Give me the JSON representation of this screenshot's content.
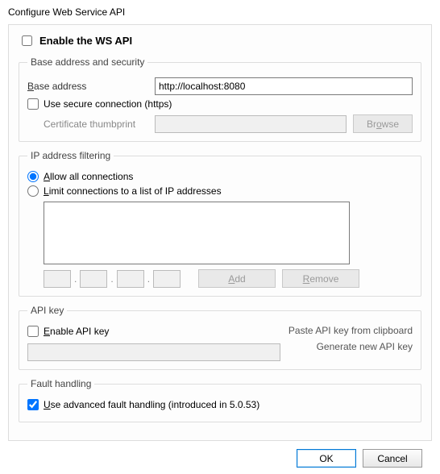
{
  "title": "Configure Web Service API",
  "enable_ws_api_label": "Enable the WS API",
  "enable_ws_api_checked": false,
  "base_group": {
    "legend": "Base address and security",
    "base_address_label": "Base address",
    "base_address_ul": "B",
    "base_address_value": "http://localhost:8080",
    "use_secure_label": "Use secure connection (https)",
    "use_secure_checked": false,
    "cert_label": "Certificate thumbprint",
    "cert_value": "",
    "browse_label": "Browse",
    "browse_ul": "o"
  },
  "ip_group": {
    "legend": "IP address filtering",
    "allow_all_label": "Allow all connections",
    "allow_all_ul": "A",
    "limit_label": "Limit connections to a list of IP addresses",
    "limit_ul": "L",
    "selected": "allow",
    "add_label": "Add",
    "add_ul": "A",
    "remove_label": "Remove",
    "remove_ul": "R"
  },
  "apikey_group": {
    "legend": "API key",
    "enable_label": "Enable API key",
    "enable_ul": "E",
    "enable_checked": false,
    "value": "",
    "paste_link": "Paste API key from clipboard",
    "generate_link": "Generate new API key"
  },
  "fault_group": {
    "legend": "Fault handling",
    "advanced_label": "Use advanced fault handling (introduced in 5.0.53)",
    "advanced_ul": "U",
    "advanced_checked": true
  },
  "footer": {
    "ok": "OK",
    "cancel": "Cancel"
  }
}
